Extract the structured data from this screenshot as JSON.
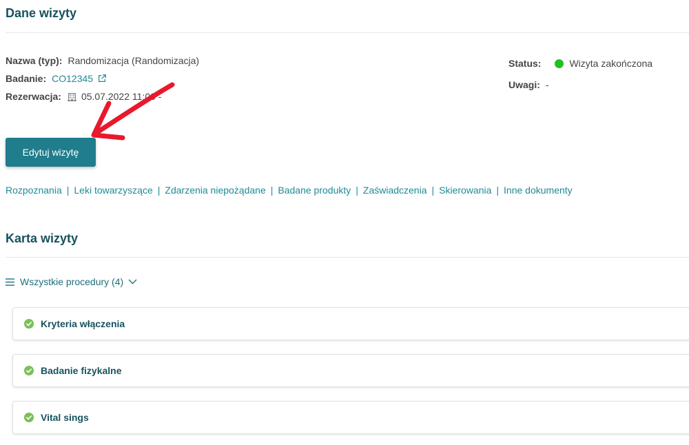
{
  "visit_details": {
    "title": "Dane wizyty",
    "name_label": "Nazwa (typ):",
    "name_value": "Randomizacja (Randomizacja)",
    "study_label": "Badanie:",
    "study_value": "CO12345",
    "reservation_label": "Rezerwacja:",
    "reservation_value": "05.07.2022 11:00 -",
    "status_label": "Status:",
    "status_value": "Wizyta zakończona",
    "notes_label": "Uwagi:",
    "notes_value": "-",
    "status_color": "#22c122"
  },
  "edit_button": {
    "label": "Edytuj wizytę"
  },
  "tabs": [
    {
      "label": "Rozpoznania"
    },
    {
      "label": "Leki towarzyszące"
    },
    {
      "label": "Zdarzenia niepożądane"
    },
    {
      "label": "Badane produkty"
    },
    {
      "label": "Zaświadczenia"
    },
    {
      "label": "Skierowania"
    },
    {
      "label": "Inne dokumenty"
    }
  ],
  "tab_separator": "|",
  "visit_card": {
    "title": "Karta wizyty",
    "procedures_toggle": "Wszystkie procedury (4)",
    "procedures": [
      {
        "title": "Kryteria włączenia"
      },
      {
        "title": "Badanie fizykalne"
      },
      {
        "title": "Vital sings"
      }
    ]
  },
  "colors": {
    "accent": "#1f7d8c",
    "link": "#1e8a96",
    "heading": "#17525e",
    "check": "#7cbf5a",
    "annotation_arrow": "#e8192c"
  }
}
